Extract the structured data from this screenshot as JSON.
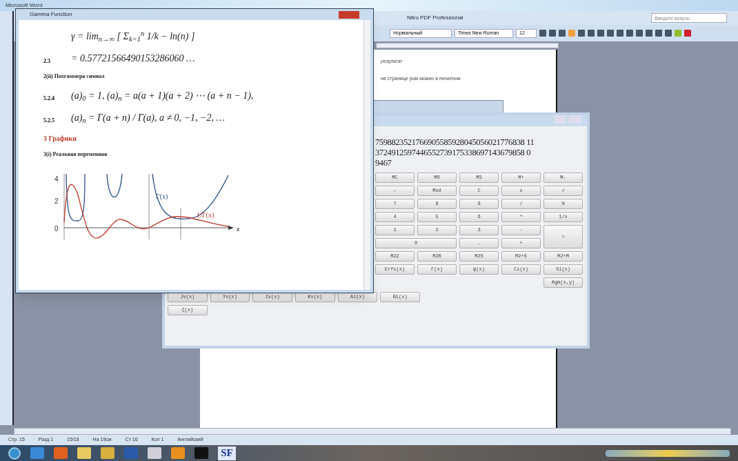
{
  "word": {
    "title": "Microsoft Word",
    "menu": [
      "Nitro PDF Professional"
    ],
    "help_search": {
      "placeholder": "Введите вопрос"
    },
    "style": "Нормальный",
    "font": "Times New Roman",
    "size": "12",
    "doc_lines": [
      "результат",
      "на странице (как можно в печатном"
    ],
    "status_bar": [
      "Стр. 15",
      "Разд 1",
      "15/18",
      "На 19см",
      "Ст 16",
      "Кол 1",
      "Английский"
    ]
  },
  "gamma_window": {
    "title": "Gamma Function",
    "blocks": [
      {
        "kind": "formula",
        "text": "γ = lim$_{n→∞}$ [ Σ$_{k=1}$$^{n}$ 1/k − ln(n) ]"
      },
      {
        "kind": "formula",
        "number": "2.3",
        "text": "= 0.57721566490153286060 …"
      },
      {
        "kind": "subheading",
        "text": "2(ii) Похгаммера символ"
      },
      {
        "kind": "formula",
        "number": "5.2.4",
        "text": "(a)$_{0}$ = 1, (a)$_{n}$ = a(a + 1)(a + 2) ⋯ (a + n − 1),"
      },
      {
        "kind": "formula",
        "number": "5.2.5",
        "text": "(a)$_{n}$ = Γ(a + n) / Γ(a),   a ≠ 0, −1, −2, …"
      },
      {
        "kind": "heading",
        "text": "3 Графики"
      },
      {
        "kind": "subheading",
        "text": "3(i) Реальная переменная"
      },
      {
        "kind": "plot",
        "y_ticks": [
          "4",
          "2",
          "0"
        ],
        "curve_labels": [
          "Γ(x)",
          "1/Γ(x)"
        ],
        "x_label": "x"
      }
    ]
  },
  "calculator": {
    "display": [
      "7598823521766905585928045056021776838 11",
      "3724912597446552739175338697143679858 0",
      "9467"
    ],
    "buttons": [
      {
        "label": "MC",
        "kind": "key"
      },
      {
        "label": "MR",
        "kind": "key"
      },
      {
        "label": "MS",
        "kind": "key"
      },
      {
        "label": "M+",
        "kind": "key"
      },
      {
        "label": "M-",
        "kind": "key"
      },
      {
        "label": "←",
        "kind": "key"
      },
      {
        "label": "Mod",
        "kind": "key"
      },
      {
        "label": "C",
        "kind": "key"
      },
      {
        "label": "±",
        "kind": "key"
      },
      {
        "label": "√",
        "kind": "key"
      },
      {
        "label": "7",
        "kind": "key"
      },
      {
        "label": "8",
        "kind": "key"
      },
      {
        "label": "9",
        "kind": "key"
      },
      {
        "label": "/",
        "kind": "key"
      },
      {
        "label": "%",
        "kind": "key"
      },
      {
        "label": "4",
        "kind": "key"
      },
      {
        "label": "5",
        "kind": "key"
      },
      {
        "label": "6",
        "kind": "key"
      },
      {
        "label": "*",
        "kind": "key"
      },
      {
        "label": "1/x",
        "kind": "key"
      },
      {
        "label": "1",
        "kind": "key"
      },
      {
        "label": "2",
        "kind": "key"
      },
      {
        "label": "3",
        "kind": "key"
      },
      {
        "label": "-",
        "kind": "key"
      },
      {
        "label": "=",
        "kind": "tall"
      },
      {
        "label": "0",
        "kind": "wide"
      },
      {
        "label": ".",
        "kind": "key"
      },
      {
        "label": "+",
        "kind": "key"
      },
      {
        "label": "M2Z",
        "kind": "key"
      },
      {
        "label": "M2R",
        "kind": "key"
      },
      {
        "label": "M2S",
        "kind": "key"
      },
      {
        "label": "M2+S",
        "kind": "key"
      },
      {
        "label": "M2+M",
        "kind": "key"
      },
      {
        "label": "Erfc(x)",
        "kind": "key"
      },
      {
        "label": "Γ(x)",
        "kind": "key"
      },
      {
        "label": "ψ(x)",
        "kind": "key"
      },
      {
        "label": "Ci(x)",
        "kind": "key"
      },
      {
        "label": "Si(x)",
        "kind": "key"
      },
      {
        "label": "Agm(x,y)",
        "kind": "end"
      }
    ],
    "bessel_buttons": [
      "Jv(x)",
      "Yv(x)",
      "Iv(x)",
      "Kv(x)",
      "Ai(x)",
      "Bi(x)",
      "ζ(x)"
    ]
  },
  "taskbar": {
    "label": "SF"
  }
}
